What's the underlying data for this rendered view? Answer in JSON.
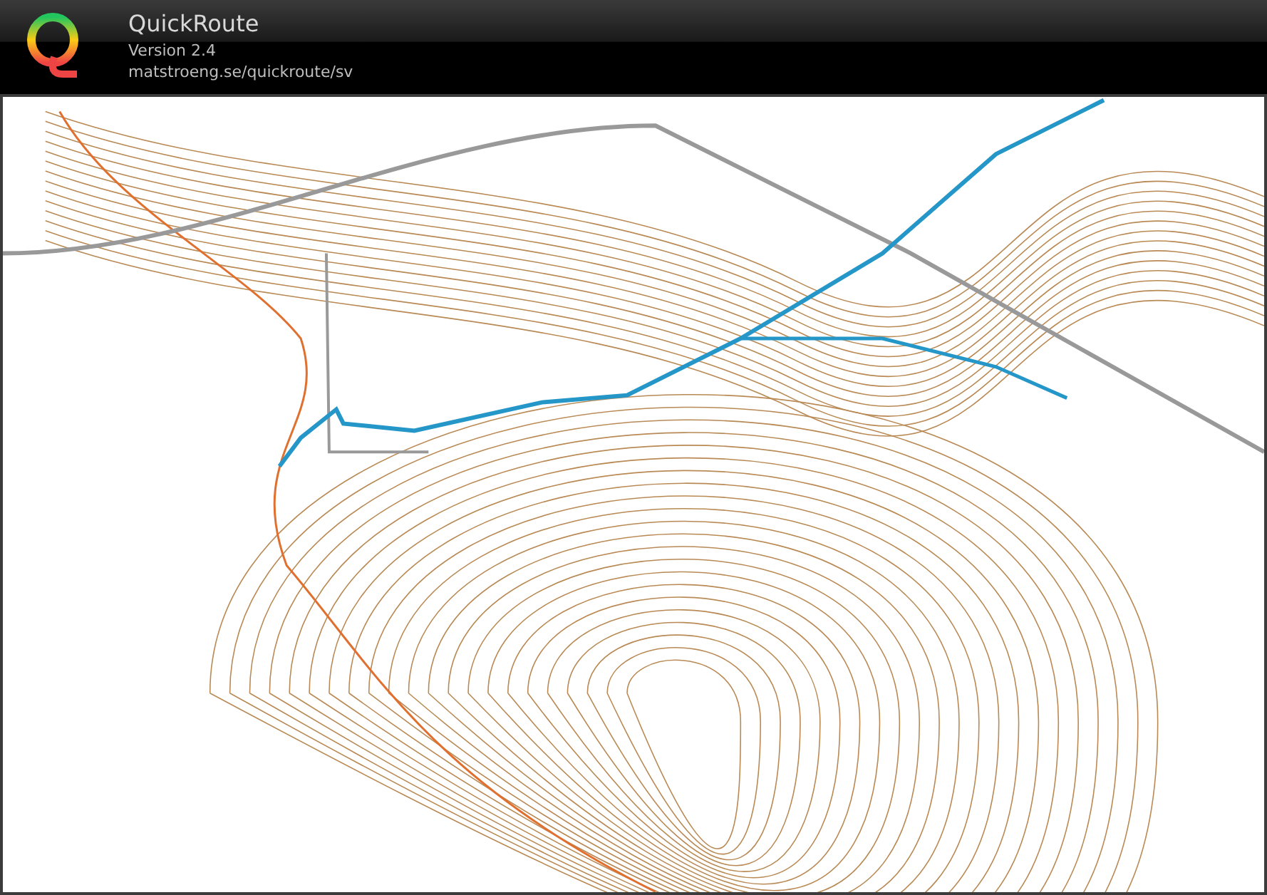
{
  "header": {
    "title": "QuickRoute",
    "version": "Version 2.4",
    "url": "matstroeng.se/quickroute/sv"
  }
}
